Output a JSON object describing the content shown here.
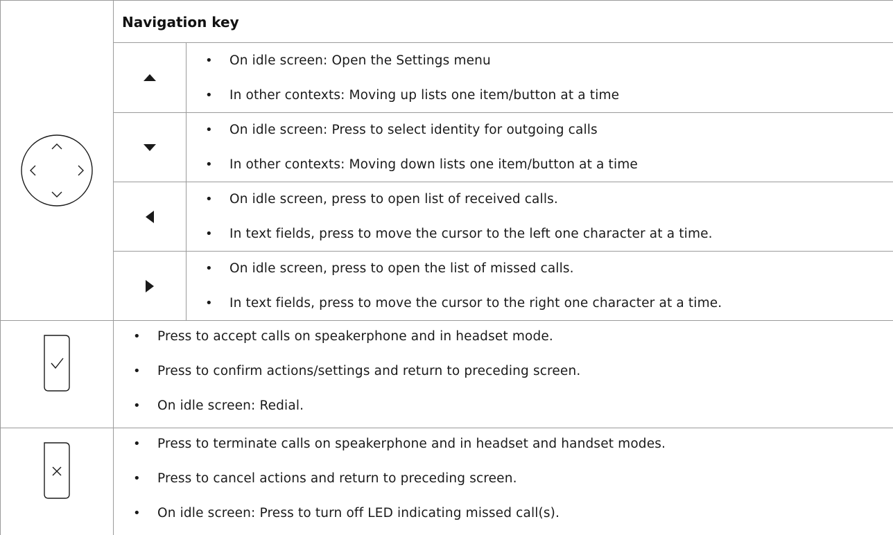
{
  "section_title": "Navigation key",
  "navigation": {
    "up": {
      "icon": "up-arrow-icon",
      "bullets": [
        "On idle screen:  Open the Settings menu",
        "In other contexts:  Moving up lists one item/button at a time"
      ]
    },
    "down": {
      "icon": "down-arrow-icon",
      "bullets": [
        "On idle screen:  Press to select identity for outgoing calls",
        "In other contexts:  Moving down lists one item/button at a time"
      ]
    },
    "left": {
      "icon": "left-arrow-icon",
      "bullets": [
        "On idle screen, press to open list of received calls.",
        "In text fields, press to move the cursor to the left one character at a time."
      ]
    },
    "right": {
      "icon": "right-arrow-icon",
      "bullets": [
        "On idle screen, press to open the list of missed calls.",
        "In text fields, press to move the cursor to the right one character at a time."
      ]
    }
  },
  "accept_key": {
    "icon": "checkmark-key-icon",
    "bullets": [
      "Press to accept calls on speakerphone and in headset mode.",
      "Press to confirm actions/settings and return to preceding screen.",
      "On idle screen:  Redial."
    ]
  },
  "cancel_key": {
    "icon": "cross-key-icon",
    "bullets": [
      "Press to terminate calls on speakerphone and in headset and handset modes.",
      "Press to cancel actions and return to preceding screen.",
      "On idle screen:  Press to turn off LED indicating missed call(s)."
    ]
  },
  "bullet_char": "•",
  "colors": {
    "border": "#9a9a9a",
    "text": "#1a1a1a",
    "icon": "#1a1a1a"
  }
}
